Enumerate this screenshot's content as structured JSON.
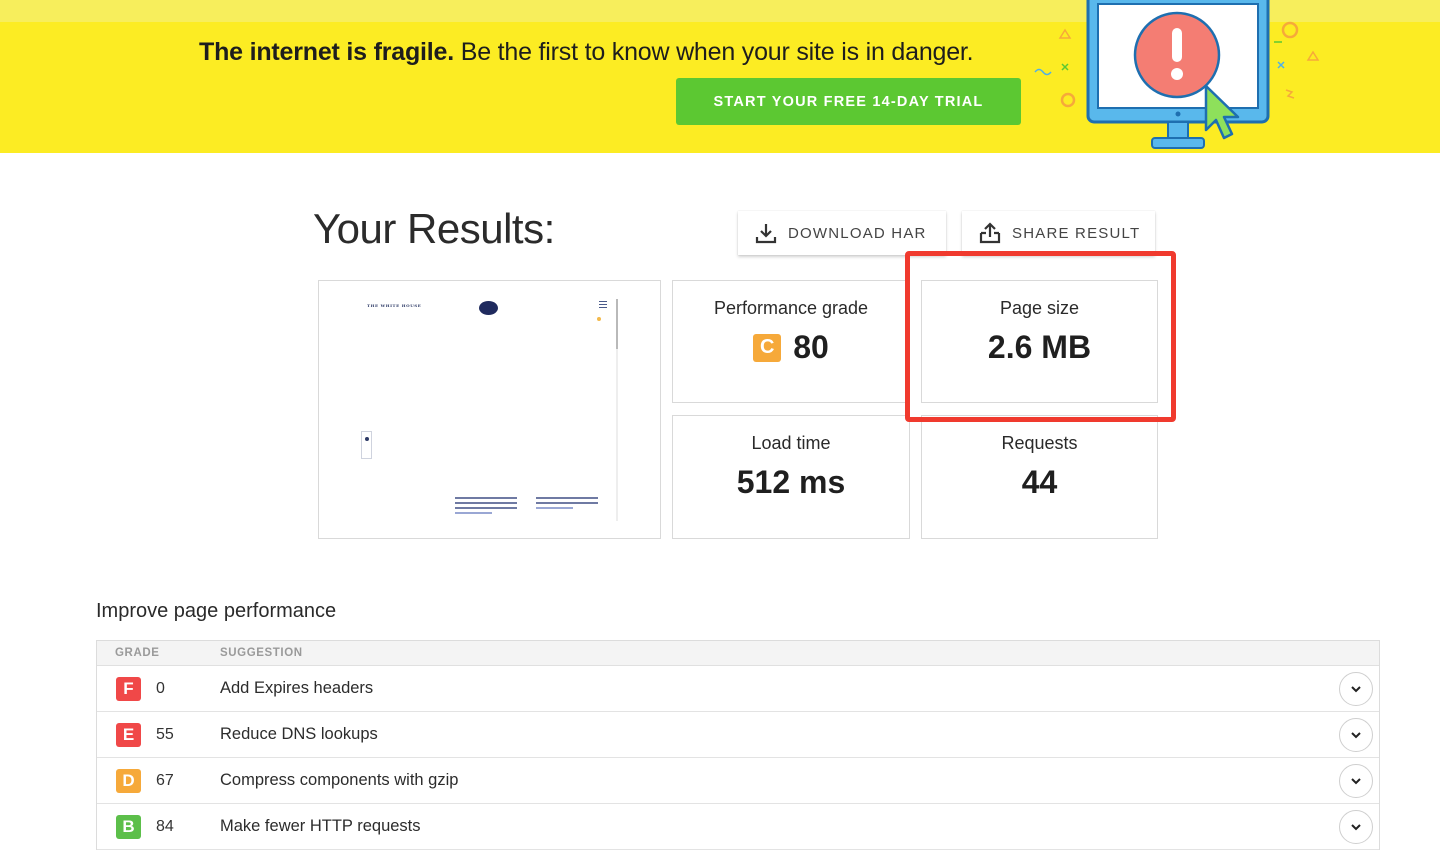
{
  "banner": {
    "headline_bold": "The internet is fragile.",
    "headline_rest": " Be the first to know when your site is in danger.",
    "cta_label": "START YOUR FREE 14-DAY TRIAL",
    "background": "#fcec23",
    "cta_color": "#5cc832",
    "illustration_icon": "monitor-alert-icon"
  },
  "results": {
    "title": "Your Results:",
    "download_label": "DOWNLOAD HAR",
    "share_label": "SHARE RESULT"
  },
  "metrics": {
    "performance": {
      "label": "Performance grade",
      "grade": "C",
      "value": "80",
      "grade_color": "#f6a93a"
    },
    "page_size": {
      "label": "Page size",
      "value": "2.6 MB"
    },
    "load_time": {
      "label": "Load time",
      "value": "512 ms"
    },
    "requests": {
      "label": "Requests",
      "value": "44"
    }
  },
  "screenshot_preview": {
    "logo_text": "THE WHITE HOUSE"
  },
  "improve": {
    "title": "Improve page performance",
    "columns": {
      "grade": "GRADE",
      "suggestion": "SUGGESTION"
    },
    "rows": [
      {
        "grade": "F",
        "score": "0",
        "suggestion": "Add Expires headers",
        "color": "#f04848"
      },
      {
        "grade": "E",
        "score": "55",
        "suggestion": "Reduce DNS lookups",
        "color": "#f04848"
      },
      {
        "grade": "D",
        "score": "67",
        "suggestion": "Compress components with gzip",
        "color": "#f6a93a"
      },
      {
        "grade": "B",
        "score": "84",
        "suggestion": "Make fewer HTTP requests",
        "color": "#5cbf4a"
      }
    ]
  },
  "highlight_color": "#f03a2e"
}
